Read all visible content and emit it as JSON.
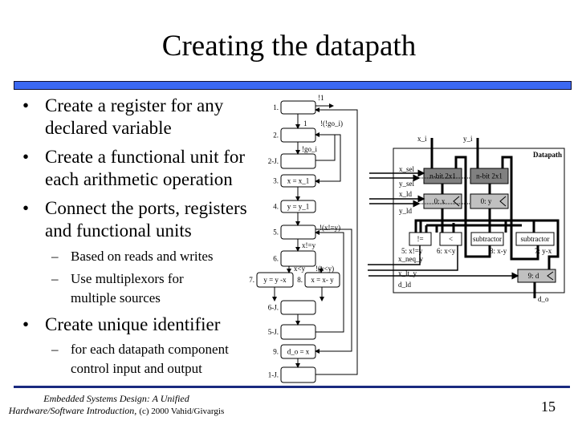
{
  "title": "Creating the datapath",
  "bullets": [
    {
      "lines": [
        "Create a register for any",
        "declared variable"
      ]
    },
    {
      "lines": [
        "Create a functional unit for",
        "each arithmetic operation"
      ]
    },
    {
      "lines": [
        "Connect the ports, registers",
        "and functional units"
      ]
    }
  ],
  "sub_bullets_1": [
    {
      "lines": [
        "Based on reads and writes"
      ]
    },
    {
      "lines": [
        "Use multiplexors for",
        "multiple sources"
      ]
    }
  ],
  "bullet_4": "Create unique identifier",
  "sub_bullets_2": [
    {
      "lines": [
        "for each datapath component",
        "control input and output"
      ]
    }
  ],
  "bullet_glyph": "•",
  "dash_glyph": "–",
  "footer": {
    "line1": "Embedded Systems Design: A Unified",
    "line2": "Hardware/Software Introduction,",
    "line2b": "(c) 2000 Vahid/Givargis"
  },
  "page_number": "15",
  "fsm": {
    "states": [
      {
        "id": "1.",
        "text": ""
      },
      {
        "id": "2.",
        "text": ""
      },
      {
        "id": "2-J.",
        "text": ""
      },
      {
        "id": "3.",
        "text": "x = x_1"
      },
      {
        "id": "4.",
        "text": "y = y_1"
      },
      {
        "id": "5.",
        "text": ""
      },
      {
        "id": "6.",
        "text": ""
      },
      {
        "id": "7.",
        "text": "y = y -x"
      },
      {
        "id": "8.",
        "text": "x = x- y"
      },
      {
        "id": "6-J.",
        "text": ""
      },
      {
        "id": "5-J.",
        "text": ""
      },
      {
        "id": "9.",
        "text": "d_o = x"
      },
      {
        "id": "1-J.",
        "text": ""
      }
    ],
    "edges": {
      "not1": "!1",
      "one": "1",
      "not_not_go": "!(!go_i)",
      "not_go": "!go_i",
      "not_xney": "!(x!=y)",
      "xney": "x!=y",
      "xlty": "x<y",
      "not_xlty": "!(x<y)"
    }
  },
  "datapath": {
    "label": "Datapath",
    "x_i": "x_i",
    "y_i": "y_i",
    "mux1": "n-bit 2x1",
    "mux2": "n-bit 2x1",
    "reg_x": "0: x",
    "reg_y": "0: y",
    "reg_d": "9: d",
    "neq": "!=",
    "lt": "<",
    "sub1": "subtractor",
    "sub2": "subtractor",
    "neq_lbl": "5: x!=y",
    "lt_lbl": "6: x<y",
    "sub1_lbl": "8: x-y",
    "sub2_lbl": "7: y-x",
    "x_sel": "x_sel",
    "y_sel": "y_sel",
    "x_ld": "x_ld",
    "y_ld": "y_ld",
    "x_neq_y": "x_neq_y",
    "x_lt_y": "x_lt_y",
    "d_ld": "d_ld",
    "d_o": "d_o",
    "reg_color": "#c0c0c0",
    "mux_color": "#808080"
  }
}
